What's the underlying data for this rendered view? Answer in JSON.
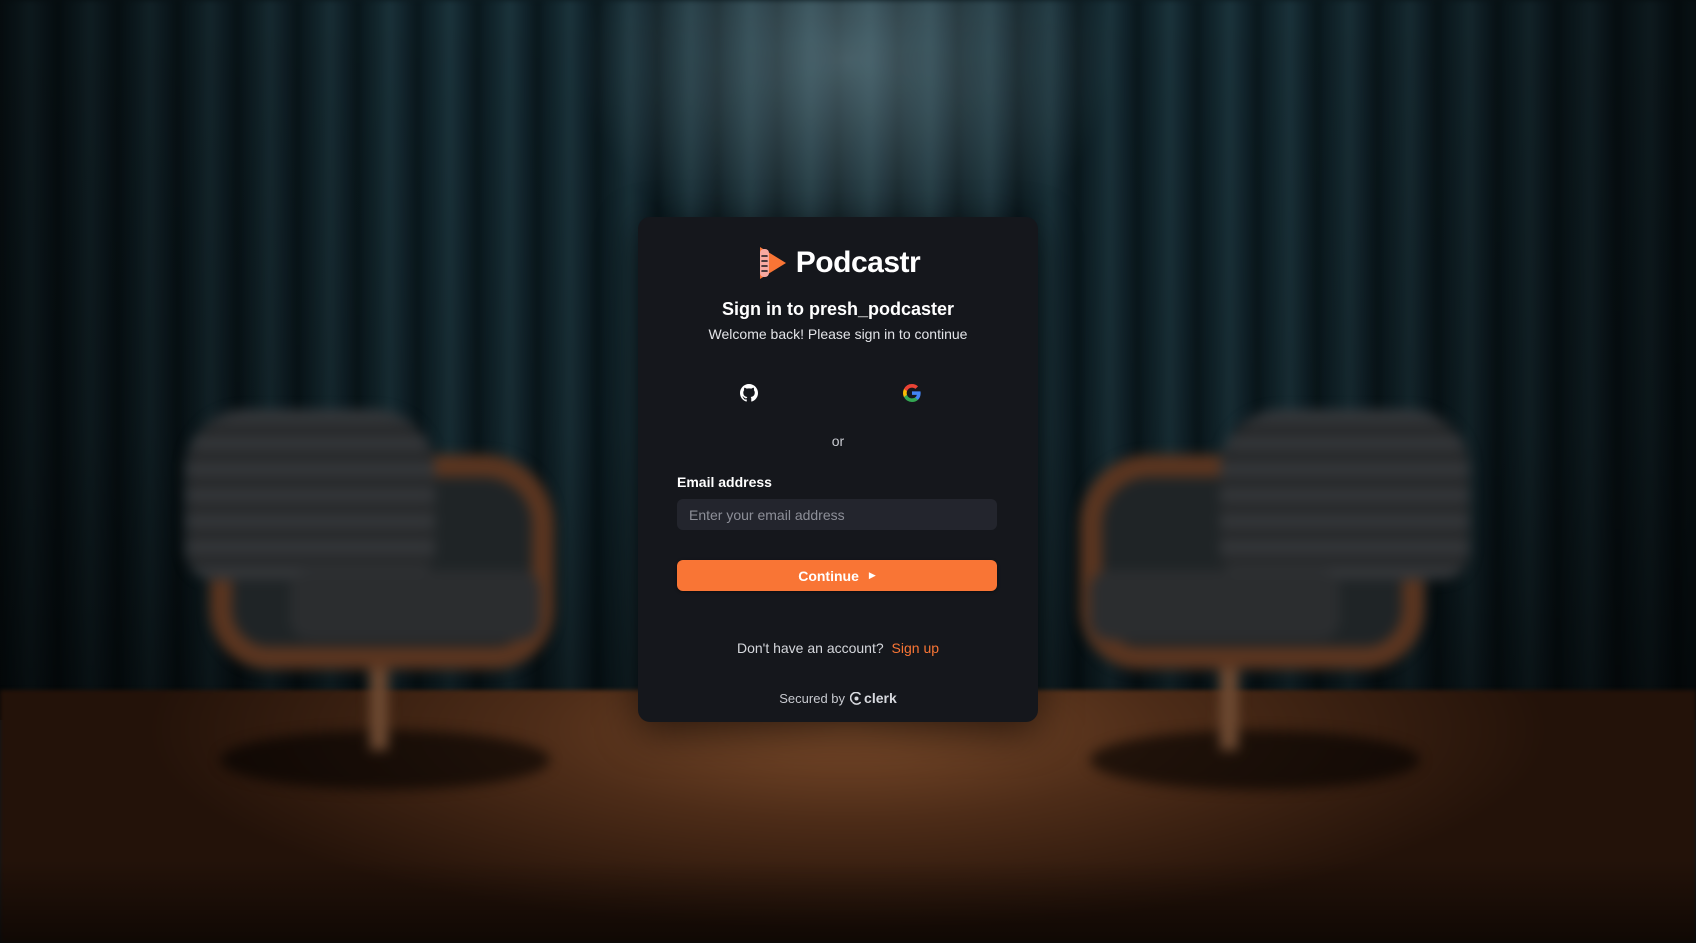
{
  "brand": {
    "name": "Podcastr",
    "logo_icon": "podcastr-logo-icon",
    "logo_color": "#F97535"
  },
  "signin": {
    "title": "Sign in to presh_podcaster",
    "subtitle": "Welcome back! Please sign in to continue",
    "social": [
      {
        "provider": "GitHub",
        "icon": "github-icon"
      },
      {
        "provider": "Google",
        "icon": "google-icon"
      }
    ],
    "divider": "or",
    "email_label": "Email address",
    "email_value": "",
    "email_placeholder": "Enter your email address",
    "continue_label": "Continue",
    "continue_icon": "caret-right-icon",
    "no_account_text": "Don't have an account?",
    "signup_link": "Sign up",
    "secured_by": "Secured by",
    "secured_brand": "clerk"
  },
  "colors": {
    "accent": "#F97535",
    "card_background": "#15171C",
    "input_background": "#23252D"
  }
}
